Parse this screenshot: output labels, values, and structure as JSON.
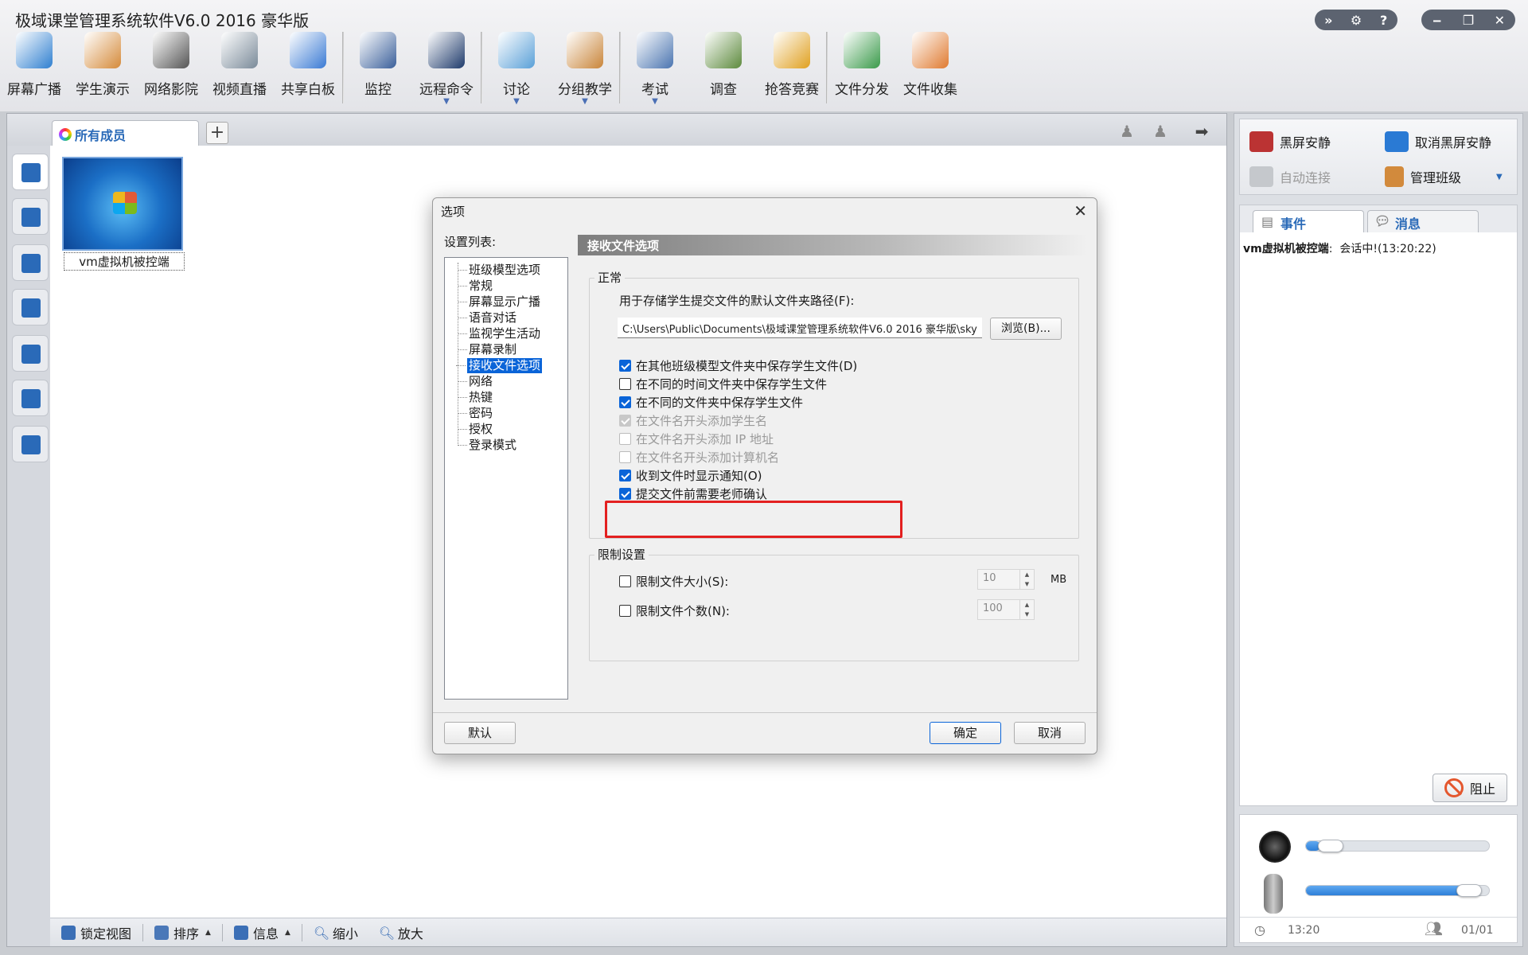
{
  "app": {
    "title": "极域课堂管理系统软件V6.0 2016 豪华版",
    "controls_left": [
      "»",
      "⚙",
      "?"
    ],
    "controls_right": [
      "‒",
      "❐",
      "✕"
    ]
  },
  "toolbar": {
    "items": [
      {
        "label": "屏幕广播",
        "icon": "screen-broadcast-icon",
        "color": "#2f7fd0"
      },
      {
        "label": "学生演示",
        "icon": "student-demo-icon",
        "color": "#d58a3a"
      },
      {
        "label": "网络影院",
        "icon": "film-reel-icon",
        "color": "#555555"
      },
      {
        "label": "视频直播",
        "icon": "webcam-icon",
        "color": "#7a8a99"
      },
      {
        "label": "共享白板",
        "icon": "whiteboard-icon",
        "color": "#3a7ad4"
      },
      {
        "label": "监控",
        "icon": "monitor-person-icon",
        "color": "#3a5f9a"
      },
      {
        "label": "远程命令",
        "icon": "command-prompt-icon",
        "color": "#1e3a6b",
        "has_dropdown": true
      },
      {
        "label": "讨论",
        "icon": "chat-bubbles-icon",
        "color": "#5aa0d8",
        "has_dropdown": true
      },
      {
        "label": "分组教学",
        "icon": "group-teaching-icon",
        "color": "#c9853a",
        "has_dropdown": true
      },
      {
        "label": "考试",
        "icon": "exam-clock-icon",
        "color": "#4a74b0",
        "has_dropdown": true
      },
      {
        "label": "调查",
        "icon": "survey-icon",
        "color": "#5d8a3d"
      },
      {
        "label": "抢答竞赛",
        "icon": "quiz-star-icon",
        "color": "#e0a020"
      },
      {
        "label": "文件分发",
        "icon": "file-send-icon",
        "color": "#3a9a4a"
      },
      {
        "label": "文件收集",
        "icon": "file-collect-icon",
        "color": "#e07a30"
      }
    ],
    "dropdown_glyph": "▼"
  },
  "main": {
    "tab_label": "所有成员",
    "add_tab": "+",
    "thumbnail_label": "vm虚拟机被控端",
    "statusbar": {
      "lock_view": "锁定视图",
      "sort": "排序",
      "info": "信息",
      "zoom_out": "缩小",
      "zoom_in": "放大"
    }
  },
  "right": {
    "black_screen": "黑屏安静",
    "cancel_black_screen": "取消黑屏安静",
    "auto_connect": "自动连接",
    "manage_class": "管理班级",
    "tab_events": "事件",
    "tab_messages": "消息",
    "event_source": "vm虚拟机被控端",
    "event_text": "会话中!(13:20:22)",
    "block_button": "阻止",
    "speaker_volume": 0.08,
    "mic_volume": 0.95,
    "time": "13:20",
    "page": "01/01"
  },
  "dialog": {
    "title": "选项",
    "close": "✕",
    "settings_list_label": "设置列表:",
    "tree": [
      "班级模型选项",
      "常规",
      "屏幕显示广播",
      "语音对话",
      "监视学生活动",
      "屏幕录制",
      "接收文件选项",
      "网络",
      "热键",
      "密码",
      "授权",
      "登录模式"
    ],
    "selected_tree_index": 6,
    "section_title": "接收文件选项",
    "group_normal": "正常",
    "path_label": "用于存储学生提交文件的默认文件夹路径(F):",
    "path_value": "C:\\Users\\Public\\Documents\\极域课堂管理系统软件V6.0 2016 豪华版\\sky",
    "browse": "浏览(B)...",
    "checkboxes": [
      {
        "label": "在其他班级模型文件夹中保存学生文件(D)",
        "checked": true,
        "enabled": true
      },
      {
        "label": "在不同的时间文件夹中保存学生文件",
        "checked": false,
        "enabled": true
      },
      {
        "label": "在不同的文件夹中保存学生文件",
        "checked": true,
        "enabled": true
      },
      {
        "label": "在文件名开头添加学生名",
        "checked": true,
        "enabled": false
      },
      {
        "label": "在文件名开头添加 IP 地址",
        "checked": false,
        "enabled": false
      },
      {
        "label": "在文件名开头添加计算机名",
        "checked": false,
        "enabled": false
      },
      {
        "label": "收到文件时显示通知(O)",
        "checked": true,
        "enabled": true
      },
      {
        "label": "提交文件前需要老师确认",
        "checked": true,
        "enabled": true
      }
    ],
    "group_limits": "限制设置",
    "limit_size_label": "限制文件大小(S):",
    "limit_size_value": "10",
    "limit_size_unit": "MB",
    "limit_count_label": "限制文件个数(N):",
    "limit_count_value": "100",
    "default_button": "默认",
    "ok_button": "确定",
    "cancel_button": "取消"
  },
  "colors": {
    "accent": "#0a64d8",
    "highlight_box": "#e32020",
    "link_blue": "#2a6ab8"
  }
}
